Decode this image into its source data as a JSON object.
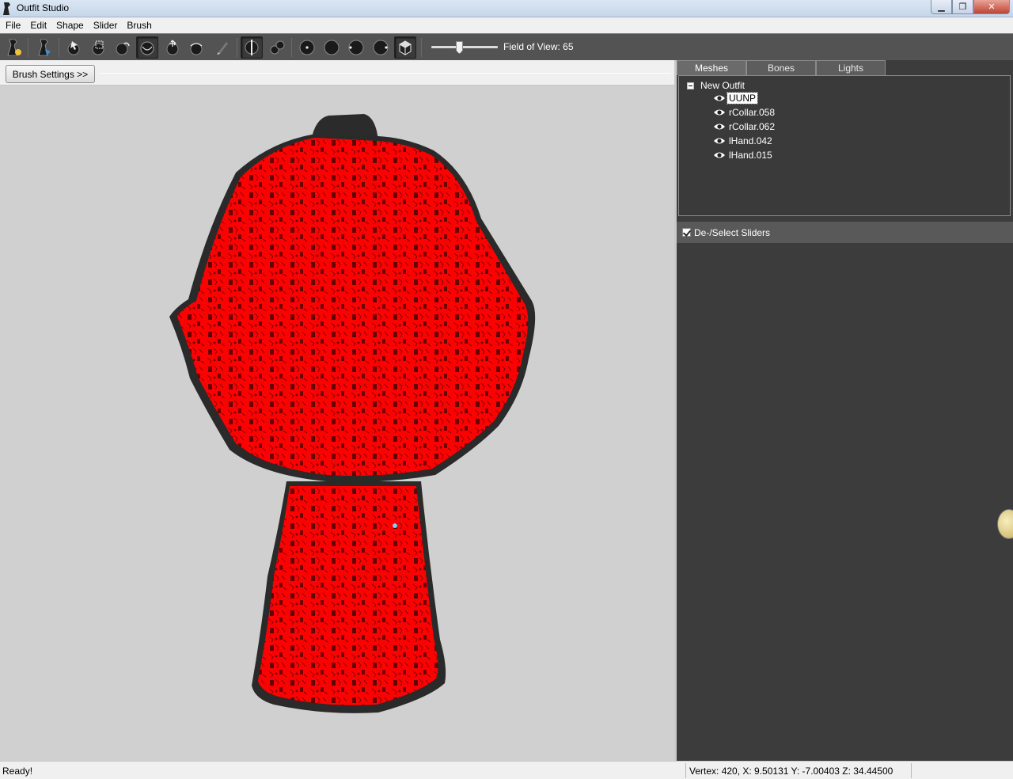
{
  "window": {
    "title": "Outfit Studio"
  },
  "menu": [
    "File",
    "Edit",
    "Shape",
    "Slider",
    "Brush"
  ],
  "toolbar": {
    "fov_label": "Field of View: 65",
    "fov_value": 65,
    "buttons": [
      "new-project",
      "load-outfit",
      "select-tool",
      "mask-tool",
      "inflate-brush",
      "deflate-brush",
      "move-brush",
      "smooth-brush",
      "weight-brush",
      "x-mirror",
      "connected-only",
      "view-front",
      "view-back",
      "view-left",
      "view-right",
      "perspective"
    ]
  },
  "left": {
    "brush_settings_label": "Brush Settings >>"
  },
  "tabs": [
    "Meshes",
    "Bones",
    "Lights"
  ],
  "active_tab": "Meshes",
  "meshes": {
    "root": "New Outfit",
    "items": [
      "UUNP",
      "rCollar.058",
      "rCollar.062",
      "lHand.042",
      "lHand.015"
    ],
    "selected": "UUNP"
  },
  "sliders": {
    "header_label": "De-/Select Sliders",
    "checked": true
  },
  "status": {
    "left": "Ready!",
    "right": "Vertex: 420, X: 9.50131 Y: -7.00403 Z: 34.44500"
  },
  "colors": {
    "garment": "#ff0000",
    "trim": "#2a2a2a",
    "viewport_bg": "#d0d0d0"
  }
}
